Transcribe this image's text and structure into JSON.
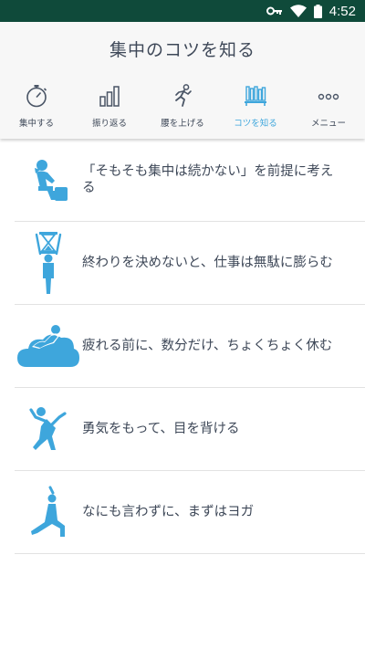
{
  "status_bar": {
    "time": "4:52"
  },
  "header": {
    "title": "集中のコツを知る"
  },
  "tabs": [
    {
      "label": "集中する",
      "icon": "stopwatch-icon"
    },
    {
      "label": "振り返る",
      "icon": "bar-chart-icon"
    },
    {
      "label": "腰を上げる",
      "icon": "running-person-icon"
    },
    {
      "label": "コツを知る",
      "icon": "bookshelf-icon",
      "active": true
    },
    {
      "label": "メニュー",
      "icon": "more-dots-icon"
    }
  ],
  "tips": [
    {
      "text": "「そもそも集中は続かない」を前提に考える",
      "icon": "thinker-figure-icon"
    },
    {
      "text": "終わりを決めないと、仕事は無駄に膨らむ",
      "icon": "hourglass-figure-icon"
    },
    {
      "text": "疲れる前に、数分だけ、ちょくちょく休む",
      "icon": "cloud-rest-figure-icon"
    },
    {
      "text": "勇気をもって、目を背ける",
      "icon": "looking-away-figure-icon"
    },
    {
      "text": "なにも言わずに、まずはヨガ",
      "icon": "yoga-figure-icon"
    }
  ],
  "colors": {
    "status_bar": "#0f4a3a",
    "header_bg": "#f7f7f7",
    "text": "#3e4858",
    "accent": "#3ea6dc",
    "divider": "#e2e2e2"
  }
}
